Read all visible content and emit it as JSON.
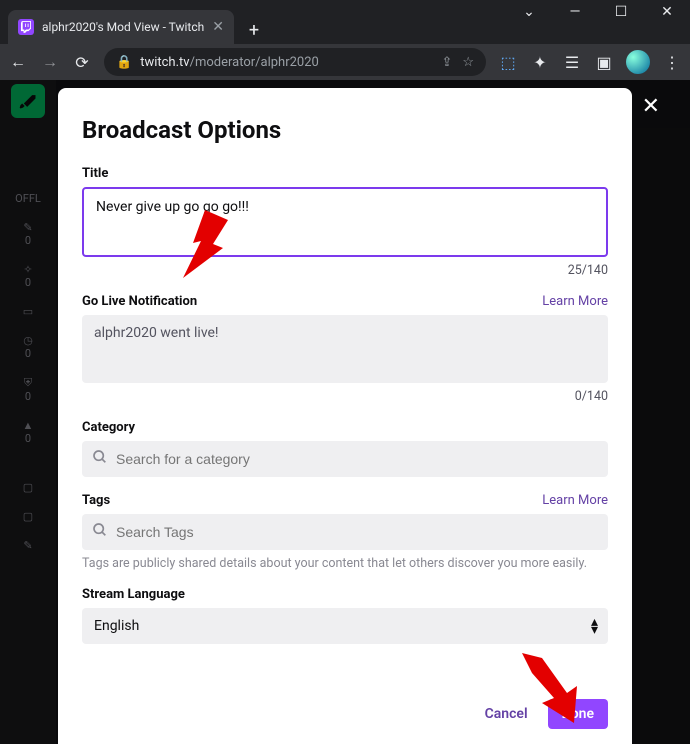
{
  "window": {
    "tab_title": "alphr2020's Mod View - Twitch",
    "url_host": "twitch.tv",
    "url_path": "/moderator/alphr2020"
  },
  "sidebar": {
    "status": "OFFL",
    "counts": [
      "0",
      "0",
      "0",
      "0",
      "0"
    ]
  },
  "modal": {
    "heading": "Broadcast Options",
    "title_section": {
      "label": "Title",
      "value": "Never give up go go go!!!",
      "counter": "25/140"
    },
    "golive_section": {
      "label": "Go Live Notification",
      "learn_more": "Learn More",
      "value": "alphr2020 went live!",
      "counter": "0/140"
    },
    "category_section": {
      "label": "Category",
      "placeholder": "Search for a category"
    },
    "tags_section": {
      "label": "Tags",
      "learn_more": "Learn More",
      "placeholder": "Search Tags",
      "help": "Tags are publicly shared details about your content that let others discover you more easily."
    },
    "language_section": {
      "label": "Stream Language",
      "value": "English"
    },
    "buttons": {
      "cancel": "Cancel",
      "done": "Done"
    }
  }
}
